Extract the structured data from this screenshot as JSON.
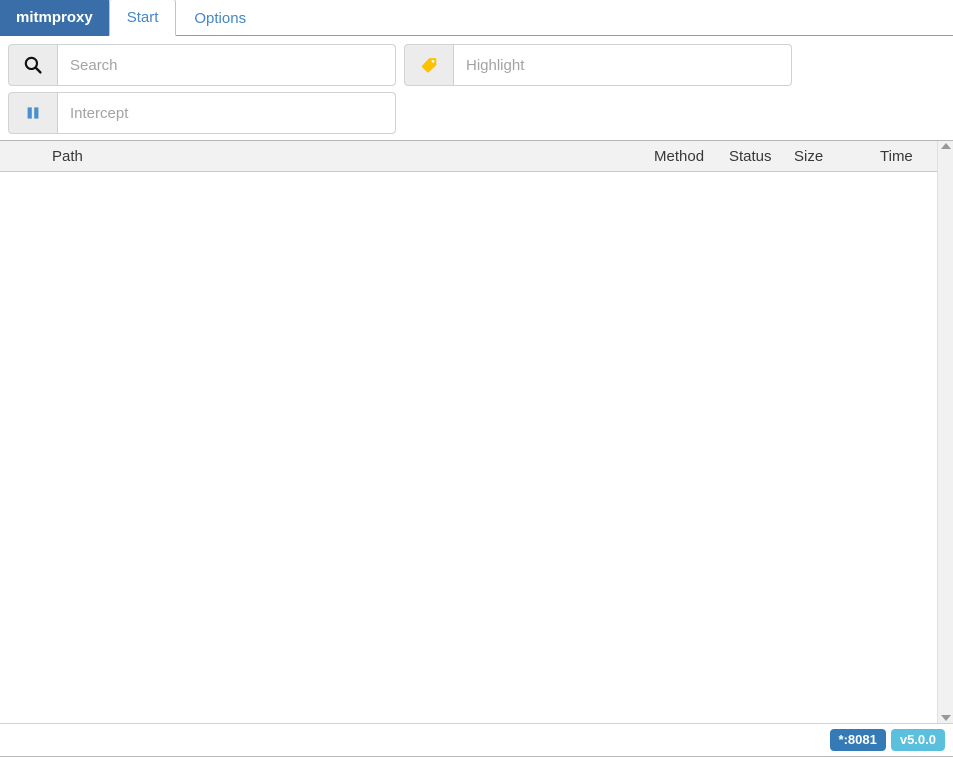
{
  "nav": {
    "brand_label": "mitmproxy",
    "tabs": [
      {
        "label": "Start",
        "active": true
      },
      {
        "label": "Options",
        "active": false
      }
    ]
  },
  "toolbar": {
    "search": {
      "icon": "search-icon",
      "value": "",
      "placeholder": "Search"
    },
    "highlight": {
      "icon": "tag-icon",
      "value": "",
      "placeholder": "Highlight"
    },
    "intercept": {
      "icon": "pause-icon",
      "value": "",
      "placeholder": "Intercept"
    }
  },
  "flow_table": {
    "columns": [
      {
        "key": "path",
        "label": "Path"
      },
      {
        "key": "method",
        "label": "Method"
      },
      {
        "key": "status",
        "label": "Status"
      },
      {
        "key": "size",
        "label": "Size"
      },
      {
        "key": "time",
        "label": "Time"
      }
    ],
    "rows": []
  },
  "scrollbar": {
    "up_icon": "chevron-up-icon",
    "down_icon": "chevron-down-icon"
  },
  "footer": {
    "port_badge": "*:8081",
    "version_badge": "v5.0.0"
  },
  "colors": {
    "brand_blue": "#3a6ea8",
    "link_blue": "#4387c7",
    "badge_port": "#337ab7",
    "badge_version": "#5bc0de",
    "tag_yellow": "#fcc200",
    "pause_blue": "#4a8fd0",
    "header_bg": "#f2f2f2"
  }
}
